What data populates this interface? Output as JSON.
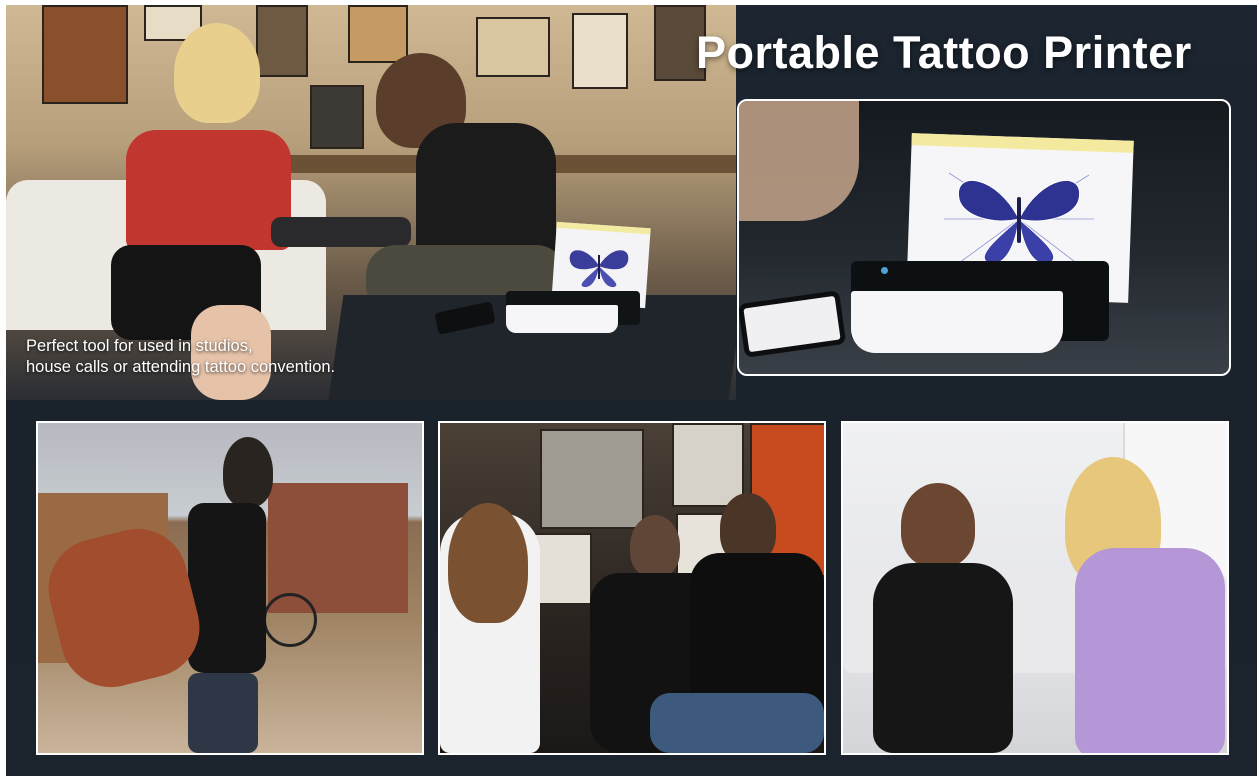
{
  "header": {
    "title": "Portable Tattoo Printer"
  },
  "hero": {
    "caption_line1": "Perfect tool for used in studios,",
    "caption_line2": "house calls or attending tattoo convention."
  },
  "colors": {
    "background": "#1c2530",
    "text": "#ffffff",
    "frame_border": "#ffffff",
    "butterfly": "#2b2f8f"
  },
  "icons": [
    "butterfly-stencil-icon",
    "tattoo-printer-icon",
    "smartphone-icon"
  ]
}
